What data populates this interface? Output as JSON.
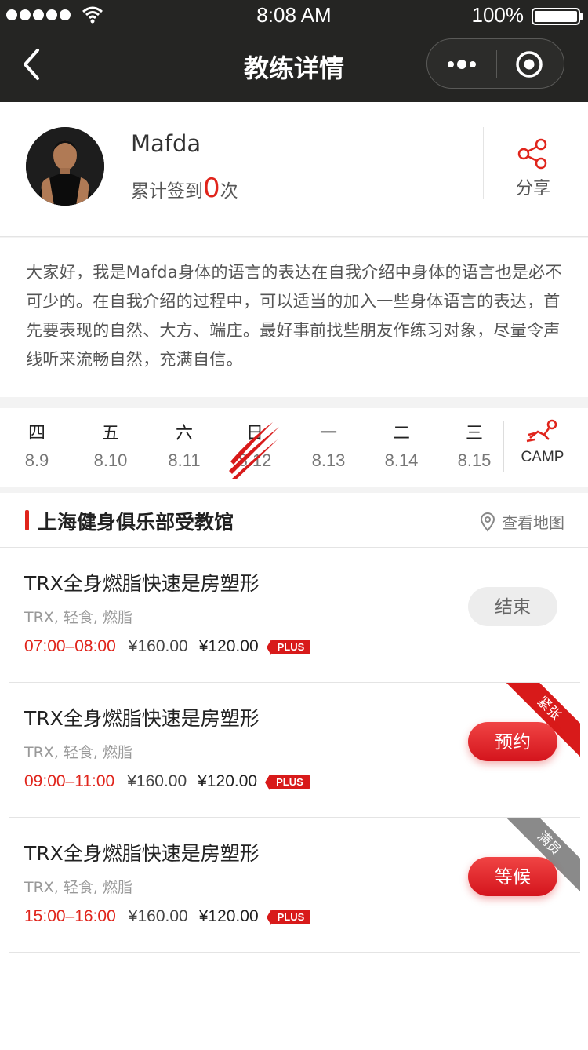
{
  "status": {
    "time": "8:08 AM",
    "battery": "100%"
  },
  "nav": {
    "title": "教练详情"
  },
  "coach": {
    "name": "Mafda",
    "checkin_prefix": "累计签到",
    "checkin_count": "0",
    "checkin_suffix": "次",
    "share_label": "分享"
  },
  "intro": "大家好，我是Mafda身体的语言的表达在自我介绍中身体的语言也是必不可少的。在自我介绍的过程中，可以适当的加入一些身体语言的表达，首先要表现的自然、大方、端庄。最好事前找些朋友作练习对象，尽量令声线听来流畅自然，充满自信。",
  "week": {
    "days": [
      {
        "weekday": "四",
        "date": "8.9"
      },
      {
        "weekday": "五",
        "date": "8.10"
      },
      {
        "weekday": "六",
        "date": "8.11"
      },
      {
        "weekday": "日",
        "date": "8.12"
      },
      {
        "weekday": "一",
        "date": "8.13"
      },
      {
        "weekday": "二",
        "date": "8.14"
      },
      {
        "weekday": "三",
        "date": "8.15"
      }
    ],
    "selected_index": 3,
    "camp_label": "CAMP"
  },
  "gym": {
    "name": "上海健身俱乐部受教馆",
    "map_label": "查看地图"
  },
  "courses": [
    {
      "name": "TRX全身燃脂快速是房塑形",
      "tags": "TRX, 轻食, 燃脂",
      "time": "07:00–08:00",
      "original_price": "¥160.00",
      "price": "¥120.00",
      "badge": "PLUS",
      "button": "结束",
      "ribbon": ""
    },
    {
      "name": "TRX全身燃脂快速是房塑形",
      "tags": "TRX, 轻食, 燃脂",
      "time": "09:00–11:00",
      "original_price": "¥160.00",
      "price": "¥120.00",
      "badge": "PLUS",
      "button": "预约",
      "ribbon": "紧张"
    },
    {
      "name": "TRX全身燃脂快速是房塑形",
      "tags": "TRX, 轻食, 燃脂",
      "time": "15:00–16:00",
      "original_price": "¥160.00",
      "price": "¥120.00",
      "badge": "PLUS",
      "button": "等候",
      "ribbon": "满员"
    }
  ],
  "colors": {
    "accent": "#e0241b",
    "nav_bg": "#252523",
    "ended_btn": "#ededed",
    "full_ribbon": "#8a8a8a"
  }
}
